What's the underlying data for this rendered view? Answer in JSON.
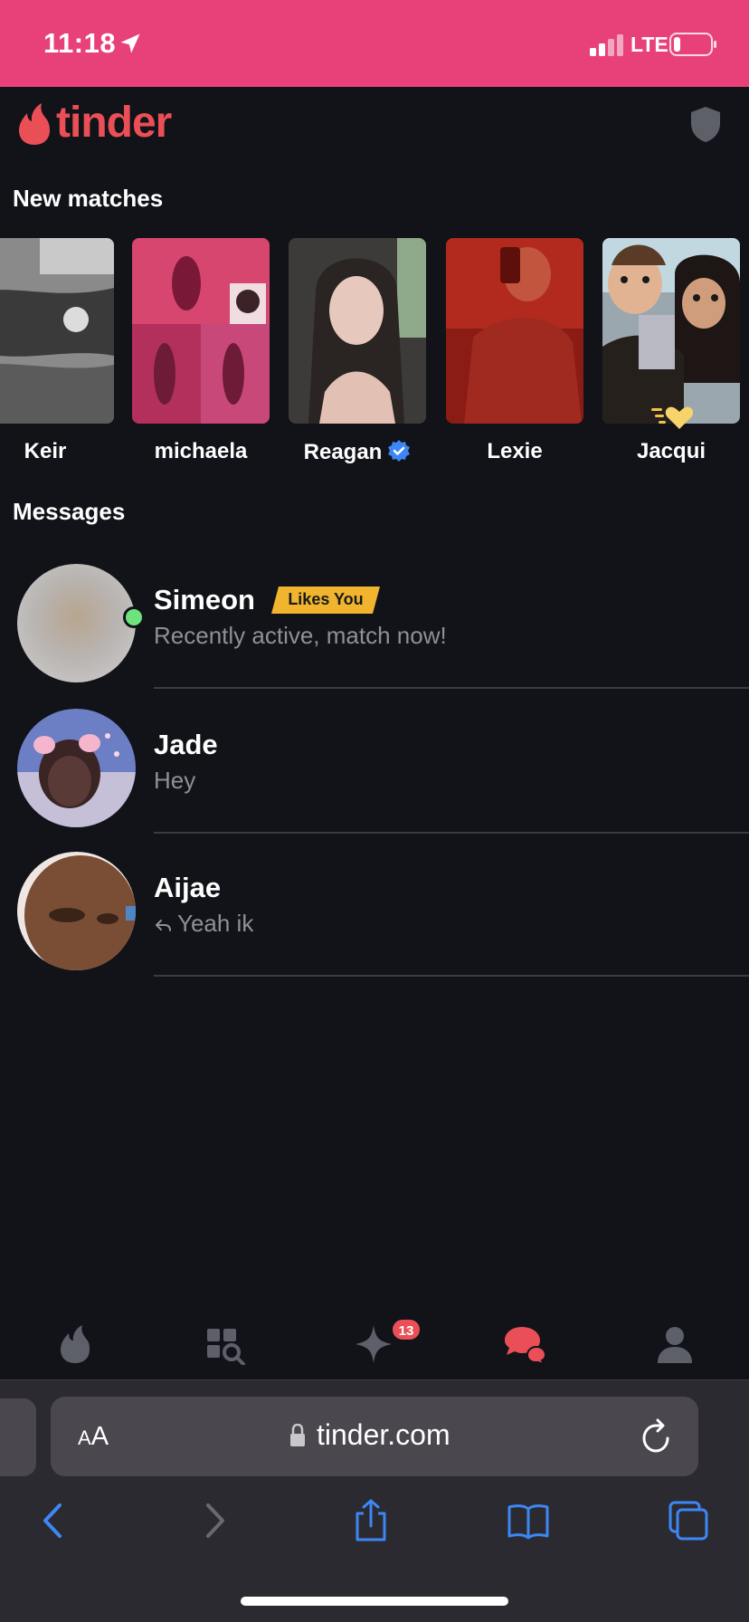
{
  "status_bar": {
    "time": "11:18",
    "network": "LTE"
  },
  "header": {
    "logo_text": "tinder",
    "brand_color": "#ea4f57",
    "safety_icon": "shield-icon"
  },
  "new_matches": {
    "title": "New matches",
    "items": [
      {
        "name": "Keir",
        "verified": false
      },
      {
        "name": "michaela",
        "verified": false
      },
      {
        "name": "Reagan",
        "verified": true
      },
      {
        "name": "Lexie",
        "verified": false
      },
      {
        "name": "Jacqui",
        "verified": false,
        "super_like": true
      }
    ]
  },
  "messages": {
    "title": "Messages",
    "items": [
      {
        "name": "Simeon",
        "badge": "Likes You",
        "preview": "Recently active, match now!",
        "online": true
      },
      {
        "name": "Jade",
        "preview": "Hey"
      },
      {
        "name": "Aijae",
        "preview": "Yeah ik",
        "replied": true
      }
    ]
  },
  "tab_bar": {
    "items": [
      "flame-icon",
      "explore-icon",
      "sparkle-icon",
      "chat-icon",
      "profile-icon"
    ],
    "active": "chat-icon",
    "sparkle_badge": "13"
  },
  "browser": {
    "text_size_label_small": "A",
    "text_size_label_large": "A",
    "url": "tinder.com"
  }
}
